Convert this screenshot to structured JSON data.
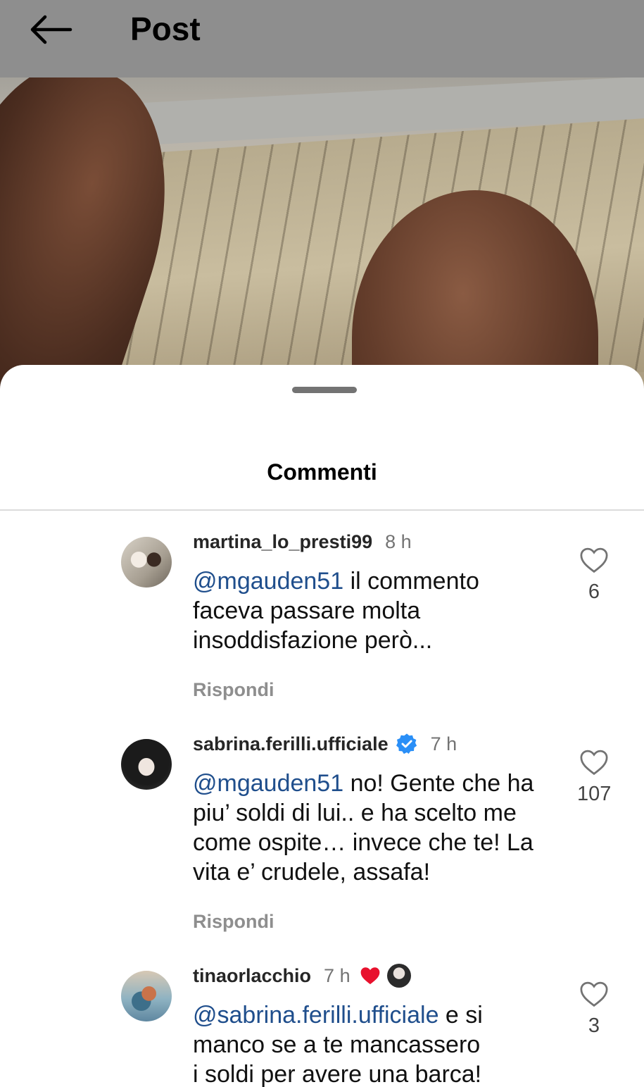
{
  "topbar": {
    "title": "Post"
  },
  "sheet": {
    "title": "Commenti"
  },
  "comments": [
    {
      "username": "martina_lo_presti99",
      "time": "8 h",
      "mention": "@mgauden51",
      "text_lines": [
        " il commento",
        "faceva passare molta",
        "insoddisfazione però..."
      ],
      "reply_label": "Rispondi",
      "likes": "6"
    },
    {
      "username": "sabrina.ferilli.ufficiale",
      "verified": true,
      "time": "7 h",
      "mention": "@mgauden51",
      "text_lines": [
        "  no! Gente che ha",
        "piu’ soldi di lui.. e ha scelto me",
        "come ospite… invece che te! La",
        "vita e’ crudele, assafa!"
      ],
      "reply_label": "Rispondi",
      "likes": "107"
    },
    {
      "username": "tinaorlacchio",
      "time": "7 h",
      "liked_by_author": true,
      "mention": "@sabrina.ferilli.ufficiale",
      "text_lines": [
        " e si",
        "manco se a te mancassero",
        "i soldi per avere una barca!"
      ],
      "likes": "3"
    }
  ],
  "colors": {
    "mention": "#1f4e8c",
    "verified": "#2a8ff7",
    "heart": "#e8112d"
  }
}
